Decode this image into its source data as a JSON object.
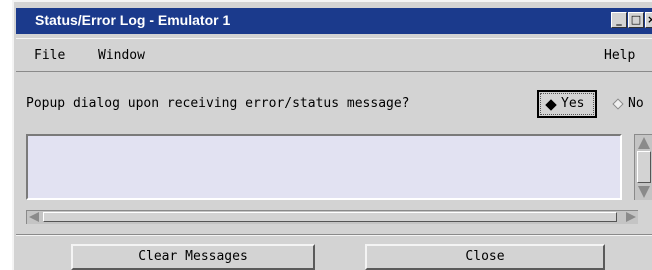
{
  "window": {
    "title": "Status/Error Log - Emulator 1",
    "controls": {
      "minimize": "_",
      "maximize": "□",
      "close": "×"
    }
  },
  "menubar": {
    "items": [
      "File",
      "Window"
    ],
    "help": "Help"
  },
  "prompt": {
    "question": "Popup dialog upon receiving error/status message?",
    "options": [
      {
        "label": "Yes",
        "selected": true
      },
      {
        "label": "No",
        "selected": false
      }
    ]
  },
  "log": {
    "text": ""
  },
  "buttons": {
    "clear": "Clear Messages",
    "close": "Close"
  },
  "colors": {
    "titlebar": "#1b3a8c",
    "panel": "#d3d3d3",
    "log_background": "#e2e2f2"
  },
  "icons": {
    "scroll_up": "arrow-up-icon",
    "scroll_down": "arrow-down-icon",
    "scroll_left": "arrow-left-icon",
    "scroll_right": "arrow-right-icon",
    "radio_selected": "diamond-filled-icon",
    "radio_unselected": "diamond-empty-icon"
  }
}
